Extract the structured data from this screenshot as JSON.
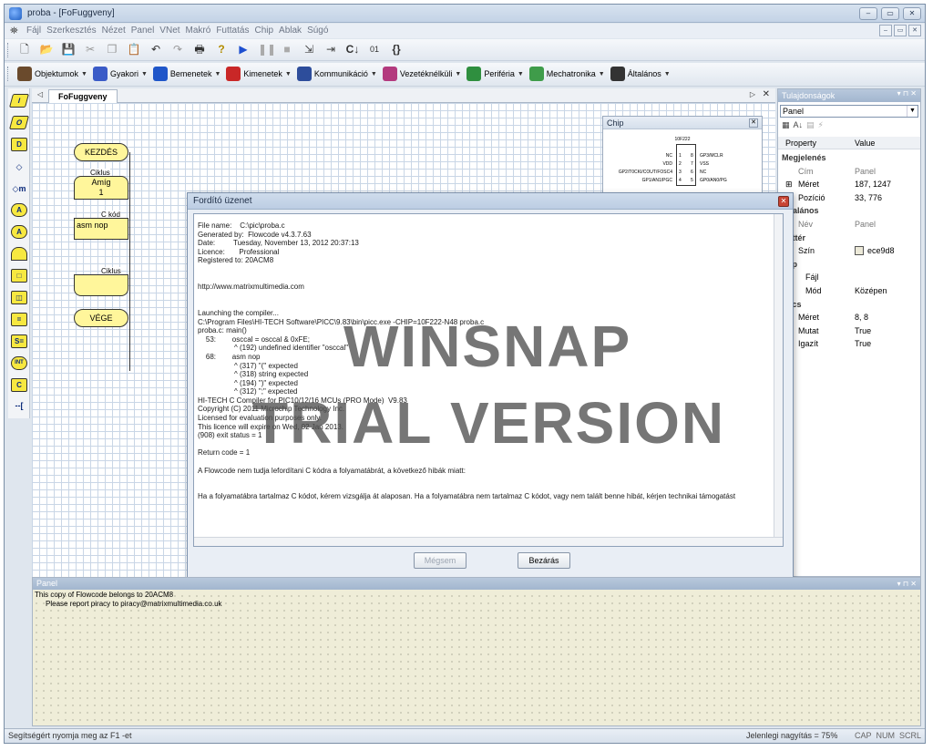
{
  "window": {
    "title": "proba - [FoFuggveny]",
    "controls": [
      "–",
      "▭",
      "✕"
    ]
  },
  "menu": {
    "items": [
      "Fájl",
      "Szerkesztés",
      "Nézet",
      "Panel",
      "VNet",
      "Makró",
      "Futtatás",
      "Chip",
      "Ablak",
      "Súgó"
    ]
  },
  "toolbar2": {
    "items": [
      {
        "label": "Objektumok",
        "color": "#6a4a2c"
      },
      {
        "label": "Gyakori",
        "color": "#3a5bc7"
      },
      {
        "label": "Bemenetek",
        "color": "#1f56c9"
      },
      {
        "label": "Kimenetek",
        "color": "#c92727"
      },
      {
        "label": "Kommunikáció",
        "color": "#2d4d9b"
      },
      {
        "label": "Vezetéknélküli",
        "color": "#b33a7e"
      },
      {
        "label": "Periféria",
        "color": "#2f8f3f"
      },
      {
        "label": "Mechatronika",
        "color": "#3f9c4a"
      },
      {
        "label": "Általános",
        "color": "#333333"
      }
    ]
  },
  "document": {
    "tab_label": "FoFuggveny",
    "close_glyph": "✕"
  },
  "flowchart": {
    "start": "KEZDÉS",
    "loop_label": "Ciklus",
    "loop_condition": "Amíg",
    "loop_value": "1",
    "ccode_label": "C kód",
    "ccode_text": "asm nop",
    "loop_end_label": "Ciklus",
    "end": "VÉGE"
  },
  "chip": {
    "title": "Chip",
    "close": "✕",
    "name": "10F222",
    "pins_left": [
      "NC",
      "VDD",
      "GP2/T0CKI/COUT/FOSC4",
      "GP1/AN1/PGC"
    ],
    "pins_right": [
      "GP3/MCLR",
      "VSS",
      "NC",
      "GP0/AN0/PG"
    ],
    "pin_numbers_left": [
      "1",
      "2",
      "3",
      "4"
    ],
    "pin_numbers_right": [
      "8",
      "7",
      "6",
      "5"
    ]
  },
  "properties": {
    "title": "Tulajdonságok",
    "selected": "Panel",
    "col_property": "Property",
    "col_value": "Value",
    "rows": [
      {
        "key": "Megjelenés",
        "value": "",
        "type": "cat"
      },
      {
        "key": "Cím",
        "value": "Panel",
        "type": "dim"
      },
      {
        "key": "Méret",
        "value": "187, 1247",
        "type": "plus"
      },
      {
        "key": "Pozíció",
        "value": "33, 776",
        "type": "plus"
      },
      {
        "key": "Általános",
        "value": "",
        "type": "cat"
      },
      {
        "key": "Név",
        "value": "Panel",
        "type": "dim"
      },
      {
        "key": "Háttér",
        "value": "",
        "type": "cat"
      },
      {
        "key": "Szín",
        "value": "ece9d8",
        "type": "swatch"
      },
      {
        "key": "Kép",
        "value": "",
        "type": "cat"
      },
      {
        "key": "Fájl",
        "value": "",
        "type": "sub"
      },
      {
        "key": "Mód",
        "value": "Középen",
        "type": "sub"
      },
      {
        "key": "Rács",
        "value": "",
        "type": "cat"
      },
      {
        "key": "Méret",
        "value": "8, 8",
        "type": "plus"
      },
      {
        "key": "Mutat",
        "value": "True",
        "type": "plain"
      },
      {
        "key": "Igazít",
        "value": "True",
        "type": "plain"
      }
    ],
    "swatch_color": "#ece9d8"
  },
  "dialog": {
    "title": "Fordító üzenet",
    "close": "✕",
    "log": [
      "File name:    C:\\pic\\proba.c",
      "Generated by:  Flowcode v4.3.7.63",
      "Date:         Tuesday, November 13, 2012 20:37:13",
      "Licence:       Professional",
      "Registered to: 20ACM8",
      "",
      "",
      "http://www.matrixmultimedia.com",
      "",
      "",
      "Launching the compiler...",
      "C:\\Program Files\\HI-TECH Software\\PICC\\9.83\\bin\\picc.exe -CHIP=10F222-N48 proba.c",
      "proba.c: main()",
      "    53:        osccal = osccal & 0xFE;",
      "                  ^ (192) undefined identifier \"osccal\"",
      "    68:        asm nop",
      "                  ^ (317) \"(\" expected",
      "                  ^ (318) string expected",
      "                  ^ (194) \")\" expected",
      "                  ^ (312) \";\" expected",
      "HI-TECH C Compiler for PIC10/12/16 MCUs (PRO Mode)  V9.83",
      "Copyright (C) 2011 Microchip Technology Inc.",
      "Licensed for evaluation purposes only.",
      "This licence will expire on Wed, 02 Jan 2013.",
      "(908) exit status = 1",
      "",
      "Return code = 1",
      "",
      "A Flowcode nem tudja lefordítani C kódra a folyamatábrát, a következő hibák miatt:",
      "",
      "",
      "Ha a folyamatábra tartalmaz C kódot, kérem vizsgálja át alaposan. Ha a folyamatábra nem tartalmaz C kódot, vagy nem talált benne hibát, kérjen technikai támogatást"
    ],
    "cancel_label": "Mégsem",
    "close_label": "Bezárás"
  },
  "watermark": {
    "line1": "WINSNAP",
    "line2": "TRIAL VERSION"
  },
  "bottom_panel": {
    "title": "Panel",
    "line1": "This copy of Flowcode belongs to 20ACM8",
    "line2": "Please report piracy to piracy@matrixmultimedia.co.uk"
  },
  "status": {
    "help": "Segítségért nyomja meg az F1 -et",
    "zoom": "Jelenlegi nagyítás = 75%",
    "keys": [
      "CAP",
      "NUM",
      "SCRL"
    ]
  }
}
